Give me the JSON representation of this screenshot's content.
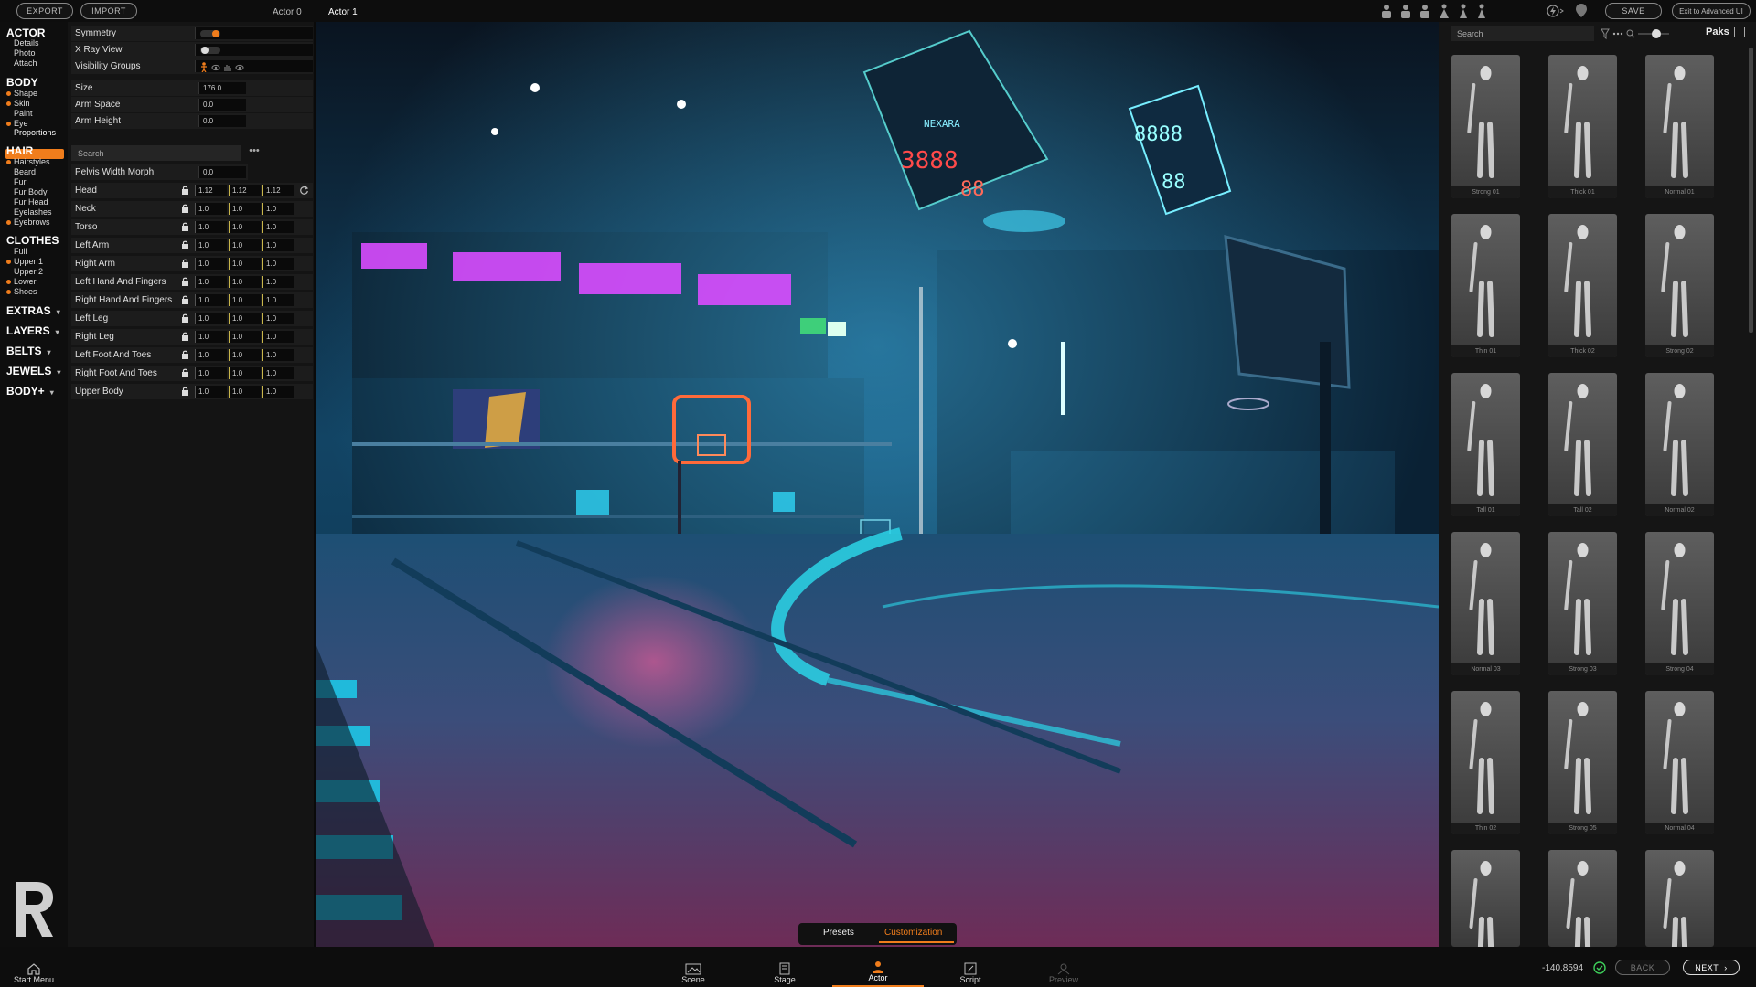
{
  "topbar": {
    "export_label": "EXPORT",
    "import_label": "IMPORT",
    "actor_tabs": [
      "Actor 0",
      "Actor 1"
    ],
    "save_label": "SAVE",
    "advanced_label": "Exit to Advanced UI"
  },
  "nav": {
    "actor": {
      "title": "ACTOR",
      "items": [
        "Details",
        "Photo",
        "Attach"
      ]
    },
    "body": {
      "title": "BODY",
      "items": [
        "Shape",
        "Skin",
        "Paint",
        "Eye",
        "Proportions"
      ]
    },
    "hair": {
      "title": "HAIR",
      "items": [
        "Hairstyles",
        "Beard",
        "Fur",
        "Fur Body",
        "Fur Head",
        "Eyelashes",
        "Eyebrows"
      ]
    },
    "clothes": {
      "title": "CLOTHES",
      "items": [
        "Full",
        "Upper 1",
        "Upper 2",
        "Lower",
        "Shoes"
      ]
    },
    "collapsed": [
      "EXTRAS",
      "LAYERS",
      "BELTS",
      "JEWELS",
      "BODY+"
    ]
  },
  "panel": {
    "symmetry_label": "Symmetry",
    "xray_label": "X Ray View",
    "visibility_label": "Visibility Groups",
    "size_label": "Size",
    "size_value": "176.0",
    "arm_space_label": "Arm Space",
    "arm_space_value": "0.0",
    "arm_height_label": "Arm Height",
    "arm_height_value": "0.0",
    "search_placeholder": "Search",
    "pelvis_label": "Pelvis Width Morph",
    "pelvis_value": "0.0",
    "rows": [
      {
        "label": "Head",
        "v": [
          "1.12",
          "1.12",
          "1.12"
        ]
      },
      {
        "label": "Neck",
        "v": [
          "1.0",
          "1.0",
          "1.0"
        ]
      },
      {
        "label": "Torso",
        "v": [
          "1.0",
          "1.0",
          "1.0"
        ]
      },
      {
        "label": "Left Arm",
        "v": [
          "1.0",
          "1.0",
          "1.0"
        ]
      },
      {
        "label": "Right Arm",
        "v": [
          "1.0",
          "1.0",
          "1.0"
        ]
      },
      {
        "label": "Left Hand And Fingers",
        "v": [
          "1.0",
          "1.0",
          "1.0"
        ]
      },
      {
        "label": "Right Hand And Fingers",
        "v": [
          "1.0",
          "1.0",
          "1.0"
        ]
      },
      {
        "label": "Left Leg",
        "v": [
          "1.0",
          "1.0",
          "1.0"
        ]
      },
      {
        "label": "Right Leg",
        "v": [
          "1.0",
          "1.0",
          "1.0"
        ]
      },
      {
        "label": "Left Foot And Toes",
        "v": [
          "1.0",
          "1.0",
          "1.0"
        ]
      },
      {
        "label": "Right Foot And Toes",
        "v": [
          "1.0",
          "1.0",
          "1.0"
        ]
      },
      {
        "label": "Upper Body",
        "v": [
          "1.0",
          "1.0",
          "1.0"
        ]
      }
    ]
  },
  "viewport": {
    "scoreboard_texts": [
      "NEXARA",
      "3888",
      "88",
      "8888",
      "88"
    ],
    "tabs": {
      "presets": "Presets",
      "customization": "Customization"
    }
  },
  "right": {
    "search_placeholder": "Search",
    "paks_label": "Paks",
    "presets": [
      "Strong 01",
      "Thick 01",
      "Normal 01",
      "Thin 01",
      "Thick 02",
      "Strong 02",
      "Tall 01",
      "Tall 02",
      "Normal 02",
      "Normal 03",
      "Strong 03",
      "Strong 04",
      "Thin 02",
      "Strong 05",
      "Normal 04",
      "",
      "",
      ""
    ]
  },
  "bottombar": {
    "start_menu": "Start Menu",
    "nav": [
      "Scene",
      "Stage",
      "Actor",
      "Script",
      "Preview"
    ],
    "coordinate": "-140.8594",
    "back_label": "BACK",
    "next_label": "NEXT"
  },
  "colors": {
    "accent": "#f07d1c",
    "neon_cyan": "#2fd5f5",
    "neon_pink": "#d94cff"
  }
}
